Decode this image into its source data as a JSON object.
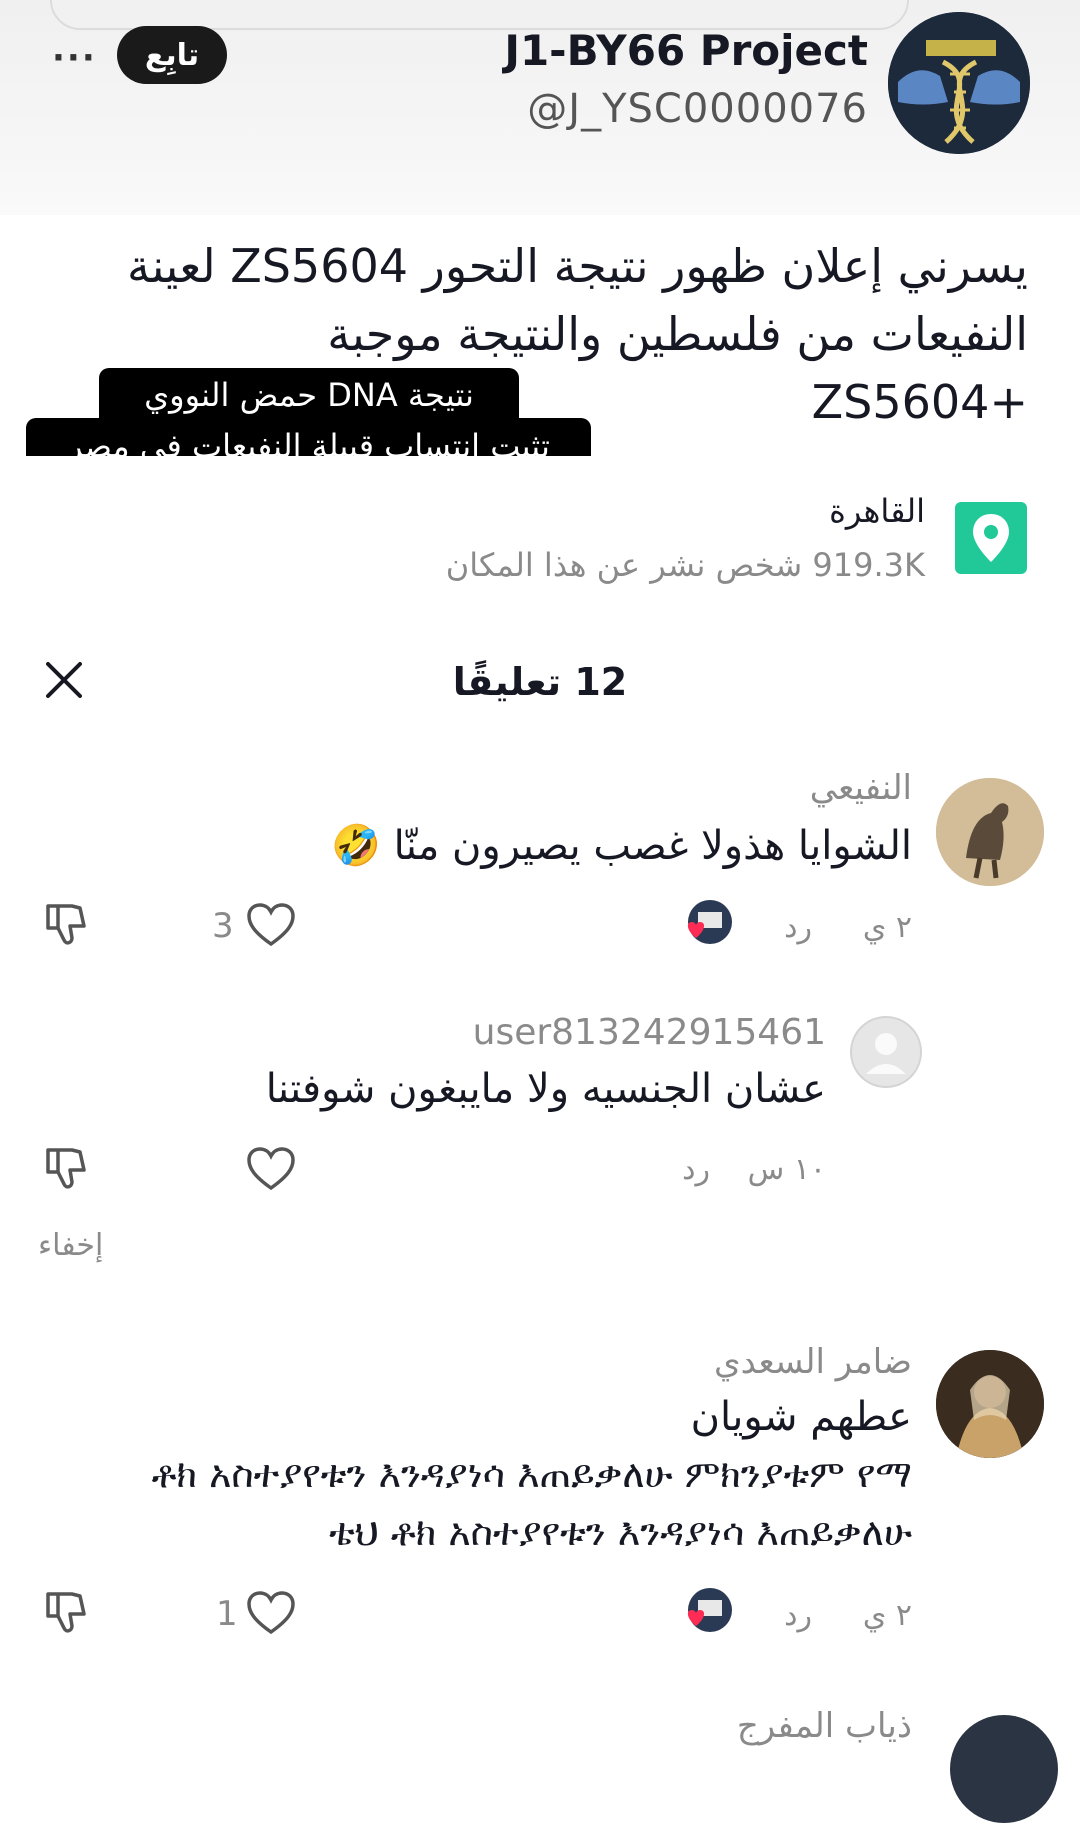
{
  "header": {
    "account_name": "J1-BY66 Project",
    "account_handle": "@J_YSC0000076",
    "follow_label": "تابِع",
    "more_label": "···"
  },
  "post": {
    "caption_line1": "يسرني إعلان ظهور نتيجة التحور ZS5604 لعينة",
    "caption_line2": "النفيعات من فلسطين والنتيجة موجبة",
    "caption_line3": "+ZS5604",
    "overlay_line1": "نتيجة DNA حمض النووي",
    "overlay_line2": "تثبت انتساب قبيلة النفيعات في مصر"
  },
  "location": {
    "name": "القاهرة",
    "stats": "919.3K شخص نشر عن هذا المكان"
  },
  "comments_header": {
    "count_label": "12 تعليقًا"
  },
  "comments": [
    {
      "username": "النفيعي",
      "text": "الشوايا هذولا غصب يصيرون منّا 🤣",
      "time": "٢ ي",
      "reply_label": "رد",
      "likes": "3"
    },
    {
      "username": "user813242915461",
      "text": "عشان الجنسيه ولا مايبغون شوفتنا",
      "time": "١٠ س",
      "reply_label": "رد",
      "likes": "",
      "hide_label": "إخفاء"
    },
    {
      "username": "ضامر السعدي",
      "text_line1": "عطهم شويان",
      "text_line2": "ቶክ አስተያየቱን እንዳያነሳ እጠይቃለሁ ምክንያቱም የማ",
      "text_line3": "ቴህ ቶክ አስተያየቱን እንዳያነሳ እጠይቃለሁ",
      "time": "٢ ي",
      "reply_label": "رد",
      "likes": "1"
    },
    {
      "username": "ذياب المفرج"
    }
  ],
  "colors": {
    "pin": "#20c997",
    "heart": "#fe2c55",
    "muted": "#8a8a8a"
  }
}
